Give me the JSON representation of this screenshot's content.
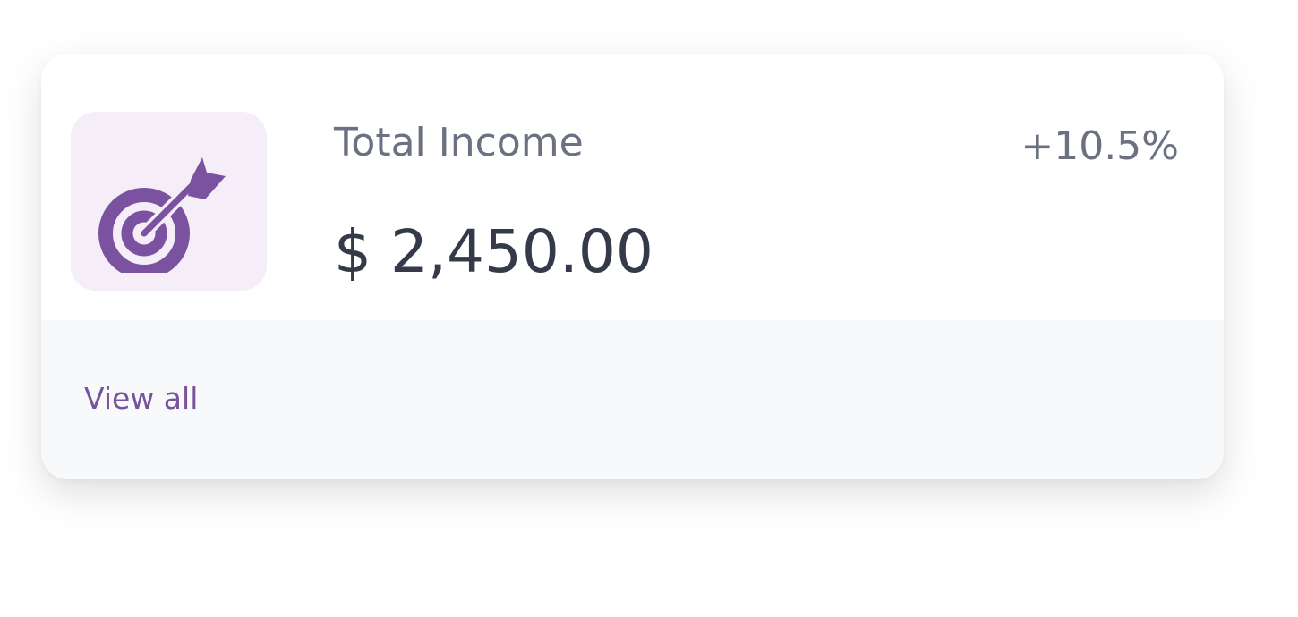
{
  "card": {
    "icon": "target-arrow-icon",
    "label": "Total Income",
    "value": "$ 2,450.00",
    "change": "+10.5%",
    "footer_link": "View all"
  },
  "colors": {
    "accent": "#7b52a0",
    "icon_tile_bg": "#f5eef9",
    "label_text": "#6b7180",
    "value_text": "#343a47",
    "footer_bg": "#f8f9fb",
    "link_text": "#77539b"
  }
}
